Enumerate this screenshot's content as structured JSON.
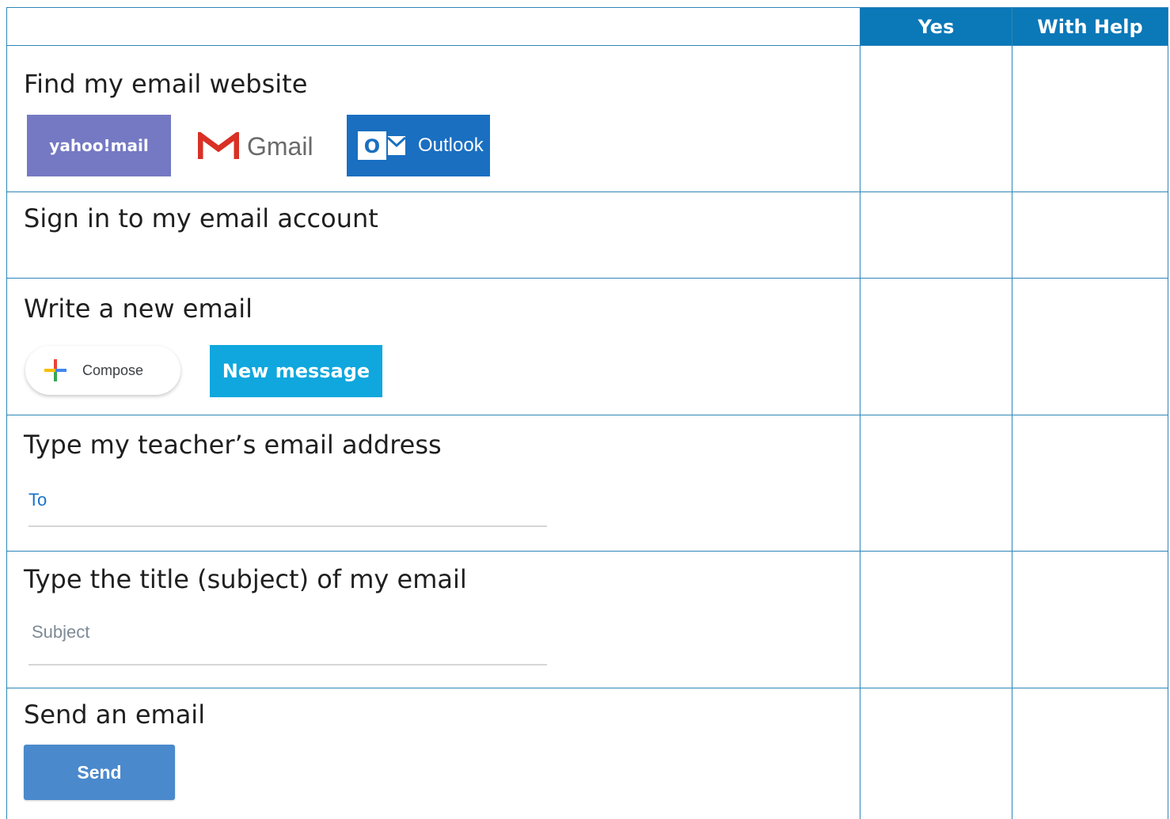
{
  "header": {
    "col_yes": "Yes",
    "col_with_help": "With Help"
  },
  "rows": [
    {
      "title": "Find my email website"
    },
    {
      "title": "Sign in to my email account"
    },
    {
      "title": "Write a new email"
    },
    {
      "title": "Type my teacher’s email address"
    },
    {
      "title": "Type the title (subject) of my email"
    },
    {
      "title": "Send an email"
    }
  ],
  "logos": {
    "yahoo": "yahoo!mail",
    "gmail": "Gmail",
    "outlook": "Outlook",
    "outlook_badge": "O"
  },
  "buttons": {
    "compose": "Compose",
    "new_message": "New message",
    "send": "Send"
  },
  "fields": {
    "to_label": "To",
    "subject_placeholder": "Subject"
  },
  "colors": {
    "header_bg": "#0b78b8",
    "grid_line": "#2e86b8",
    "yahoo_purple": "#7579c3",
    "outlook_blue": "#1a6fc1",
    "new_message_blue": "#0fa7dd",
    "send_blue": "#4a89cc",
    "gmail_red": "#d93025"
  }
}
